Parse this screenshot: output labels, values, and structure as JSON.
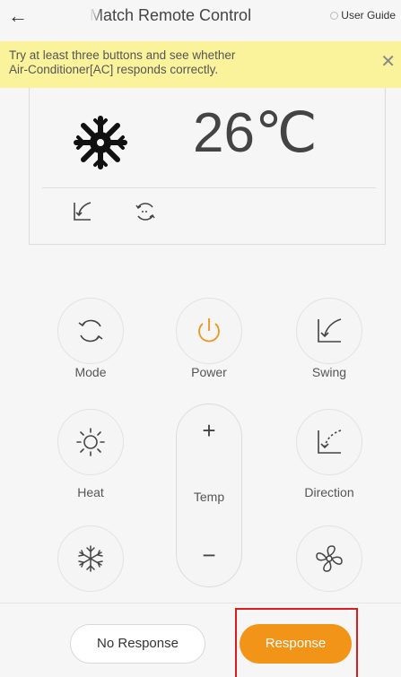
{
  "header": {
    "back_icon": "arrow-left-icon",
    "title": "Match Remote Control",
    "guide_label": "User Guide"
  },
  "tip": {
    "text_line1": "Try at least three buttons and see whether",
    "text_line2": "Air-Conditioner[AC] responds correctly.",
    "close_icon": "close-icon"
  },
  "display": {
    "mode_icon": "snowflake-icon",
    "temperature": "26℃",
    "indicator_icons": [
      "swing-icon",
      "direction-icon"
    ]
  },
  "controls": {
    "mode_label": "Mode",
    "power_label": "Power",
    "swing_label": "Swing",
    "heat_label": "Heat",
    "direction_label": "Direction",
    "temp_label": "Temp",
    "temp_plus": "+",
    "temp_minus": "−",
    "cool_icon": "snowflake-icon",
    "fan_icon": "fan-icon"
  },
  "footer": {
    "no_response_label": "No Response",
    "response_label": "Response"
  },
  "colors": {
    "accent": "#f29418",
    "power": "#f29418",
    "highlight_frame": "#d81e1e",
    "tip_background": "#fbf39b"
  }
}
